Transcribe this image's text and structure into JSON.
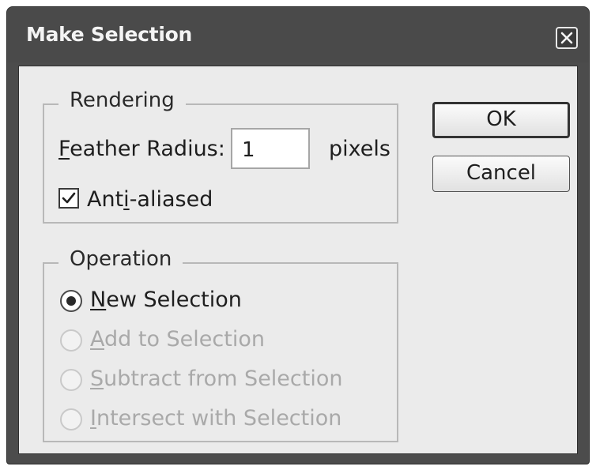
{
  "window": {
    "title": "Make Selection"
  },
  "rendering": {
    "legend": "Rendering",
    "feather_label_mnemonic": "F",
    "feather_label_rest": "eather Radius:",
    "feather_value": "1",
    "feather_unit": "pixels",
    "antialias_label_pre": "Ant",
    "antialias_label_mnemonic": "i",
    "antialias_label_post": "-aliased",
    "antialias_checked": true
  },
  "operation": {
    "legend": "Operation",
    "options": [
      {
        "mnemonic": "N",
        "rest": "ew Selection",
        "selected": true,
        "enabled": true
      },
      {
        "mnemonic": "A",
        "rest": "dd to Selection",
        "selected": false,
        "enabled": false
      },
      {
        "mnemonic": "S",
        "rest": "ubtract from Selection",
        "selected": false,
        "enabled": false
      },
      {
        "mnemonic": "I",
        "rest": "ntersect with Selection",
        "selected": false,
        "enabled": false
      }
    ]
  },
  "buttons": {
    "ok": "OK",
    "cancel": "Cancel"
  },
  "icons": {
    "close": "close-icon",
    "check": "checkmark-icon"
  }
}
